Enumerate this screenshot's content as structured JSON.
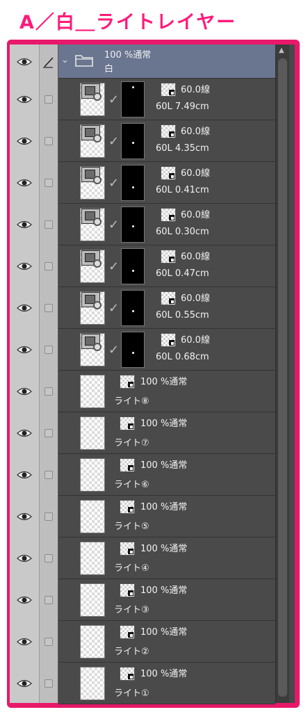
{
  "heading": "A／白＿ライトレイヤー",
  "folder": {
    "opacity_mode": "100 %通常",
    "name": "白"
  },
  "line_layers": [
    {
      "opacity_mode": "60.0線",
      "name": "60L 7.49cm"
    },
    {
      "opacity_mode": "60.0線",
      "name": "60L 4.35cm"
    },
    {
      "opacity_mode": "60.0線",
      "name": "60L 0.41cm"
    },
    {
      "opacity_mode": "60.0線",
      "name": "60L 0.30cm"
    },
    {
      "opacity_mode": "60.0線",
      "name": "60L 0.47cm"
    },
    {
      "opacity_mode": "60.0線",
      "name": "60L 0.55cm"
    },
    {
      "opacity_mode": "60.0線",
      "name": "60L 0.68cm"
    }
  ],
  "light_layers": [
    {
      "opacity_mode": "100 %通常",
      "name": "ライト⑧"
    },
    {
      "opacity_mode": "100 %通常",
      "name": "ライト⑦"
    },
    {
      "opacity_mode": "100 %通常",
      "name": "ライト⑥"
    },
    {
      "opacity_mode": "100 %通常",
      "name": "ライト⑤"
    },
    {
      "opacity_mode": "100 %通常",
      "name": "ライト④"
    },
    {
      "opacity_mode": "100 %通常",
      "name": "ライト③"
    },
    {
      "opacity_mode": "100 %通常",
      "name": "ライト②"
    },
    {
      "opacity_mode": "100 %通常",
      "name": "ライト①"
    }
  ],
  "colors": {
    "heading": "#ff1a7a",
    "frame": "#e8186a",
    "folder_bg": "#6a7590",
    "row_bg": "#4a4a4a"
  },
  "icons": {
    "eye": "eye-icon",
    "pen": "pen-icon",
    "folder": "folder-icon",
    "chevron": "chevron-down-icon",
    "check": "checkmark-icon"
  }
}
